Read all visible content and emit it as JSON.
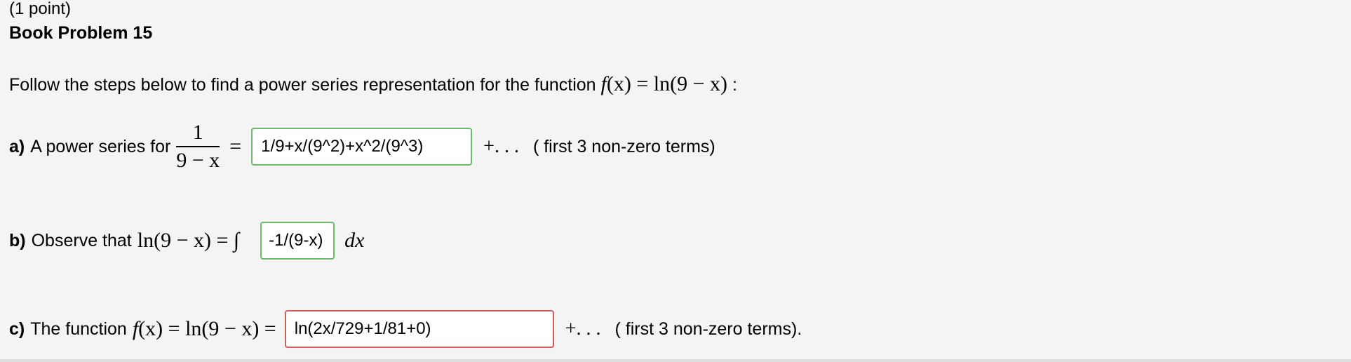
{
  "header": {
    "points": "(1 point)",
    "title": "Book Problem 15"
  },
  "intro": {
    "text": "Follow the steps below to find a power series representation for the function",
    "func_f": "f",
    "func_rest": "(x) = ln(9 − x)",
    "colon": " :"
  },
  "part_a": {
    "label": "a)",
    "text": "A power series for",
    "frac_num": "1",
    "frac_den": "9 − x",
    "equals": "=",
    "answer_value": "1/9+x/(9^2)+x^2/(9^3)",
    "answer_status": "correct",
    "continuation": "+. . .",
    "note": "( first 3 non-zero terms)"
  },
  "part_b": {
    "label": "b)",
    "text": "Observe that",
    "math_lhs": "ln(9 − x) = ∫",
    "answer_value": "-1/(9-x)",
    "answer_status": "correct",
    "dx": "dx"
  },
  "part_c": {
    "label": "c)",
    "text": "The function",
    "func_f": "f",
    "func_rest": "(x) = ln(9 − x) =",
    "answer_value": "ln(2x/729+1/81+0)",
    "answer_status": "incorrect",
    "continuation": "+. . .",
    "note": "( first 3 non-zero terms)."
  },
  "colors": {
    "correct_border": "#6dba6d",
    "incorrect_border": "#d75a5a",
    "background": "#f4f4f4"
  }
}
